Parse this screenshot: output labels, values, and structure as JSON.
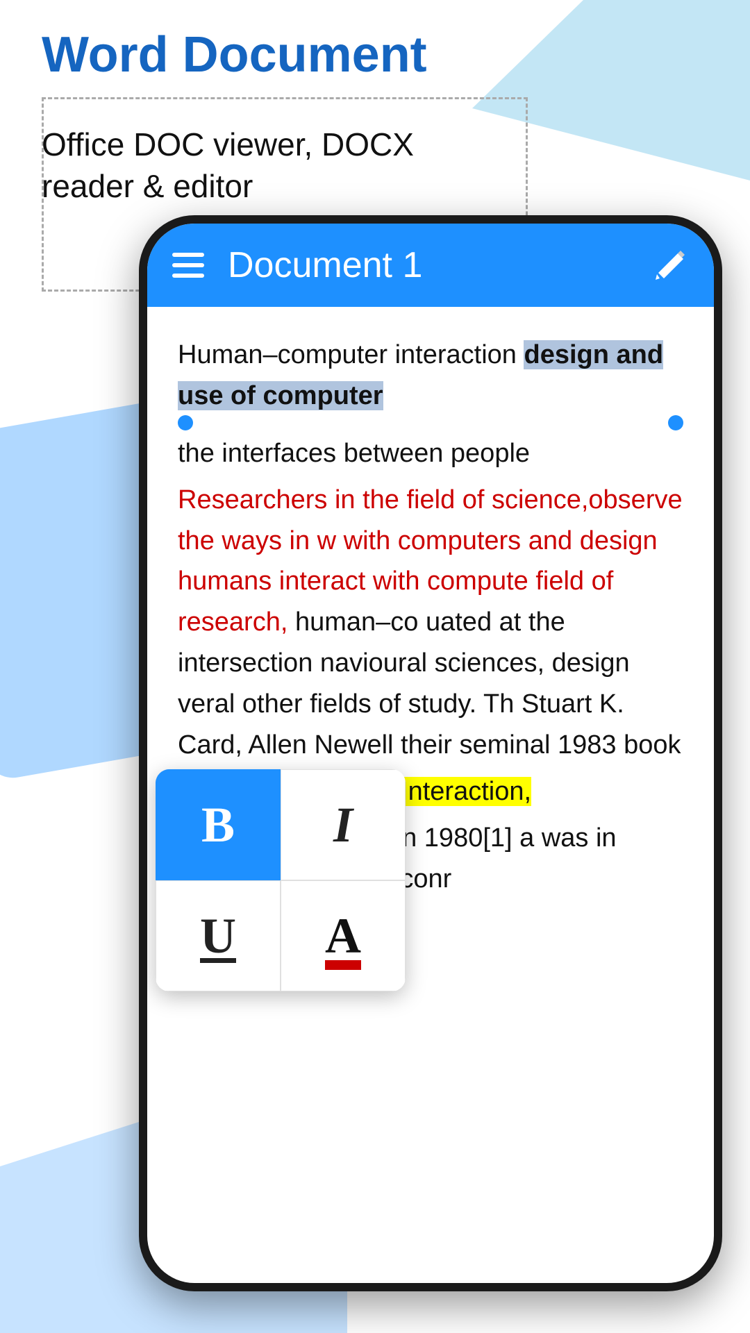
{
  "header": {
    "title": "Word Document",
    "subtitle_line1": "Office DOC viewer, DOCX",
    "subtitle_line2": "reader & editor"
  },
  "toolbar": {
    "title": "Document 1",
    "menu_icon_label": "menu",
    "edit_icon_label": "edit"
  },
  "document": {
    "paragraph1": "Human–computer interaction",
    "selected_text": "design and use of computer",
    "paragraph1_cont": "the interfaces between people",
    "paragraph2": "Researchers in the field of science,observe the ways in w with computers and design humans interact with compute field of research, human–co uated at the intersection navioural sciences, design veral other fields of study. Th Stuart K. Card, Allen Newell their seminal 1983 book",
    "highlighted_text": "Human–Computer Interaction,",
    "paragraph3": "first used the term in 1980[1] a was in 1975.[2] The term conr"
  },
  "format_toolbar": {
    "bold_label": "B",
    "italic_label": "I",
    "underline_label": "U",
    "color_label": "A"
  },
  "colors": {
    "blue_brand": "#1e90ff",
    "blue_dark": "#1565c0",
    "red_text": "#cc0000",
    "highlight_yellow": "#ffff00",
    "selection_blue": "#b0c4de"
  }
}
